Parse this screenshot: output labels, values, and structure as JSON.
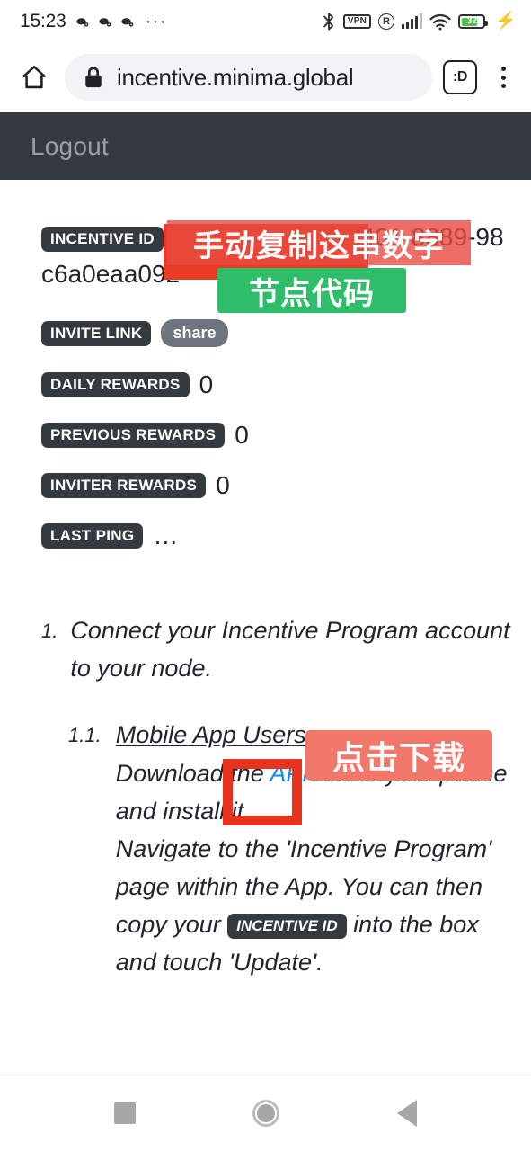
{
  "status_bar": {
    "clock": "15:23",
    "notification_icons": [
      "app-notification-icon",
      "app-notification-icon",
      "app-notification-icon"
    ],
    "overflow_dots": "···",
    "bluetooth_icon": "bluetooth-icon",
    "vpn_label": "VPN",
    "roaming_label": "R",
    "signal_icon": "cellular-signal-icon",
    "wifi_icon": "wifi-icon",
    "battery_level": "32",
    "charging_icon": "charging-bolt-icon"
  },
  "browser": {
    "home_icon": "home-icon",
    "lock_icon": "lock-icon",
    "url": "incentive.minima.global",
    "profile_label": ":D",
    "menu_icon": "overflow-menu-icon"
  },
  "site_header": {
    "logout_label": "Logout"
  },
  "content": {
    "incentive_id_label": "INCENTIVE ID",
    "incentive_id_value": "5d25f848-dedc-4401-8889-98c6a0eaa092",
    "invite_link_label": "INVITE LINK",
    "share_label": "share",
    "daily_rewards_label": "DAILY REWARDS",
    "daily_rewards_value": "0",
    "previous_rewards_label": "PREVIOUS REWARDS",
    "previous_rewards_value": "0",
    "inviter_rewards_label": "INVITER REWARDS",
    "inviter_rewards_value": "0",
    "last_ping_label": "LAST PING",
    "last_ping_value": "…"
  },
  "instructions": {
    "step1_num": "1.",
    "step1_text": "Connect your Incentive Program account to your node.",
    "step11_num": "1.1.",
    "step11_title": "Mobile App Users",
    "step11_part1": "Download the ",
    "step11_apk": "APK",
    "step11_part2": " on to your phone and install it.",
    "step11_part3": "Navigate to the 'Incentive Program' page within the App. You can then copy your ",
    "step11_inline_badge": "INCENTIVE ID",
    "step11_part4": " into the box and touch 'Update'."
  },
  "annotations": {
    "copy_digits": "手动复制这串数字",
    "node_code": "节点代码",
    "click_download": "点击下载",
    "colors": {
      "red_overlay": "#e94a40",
      "red_solid": "#ea3c24",
      "green": "#2ebd68",
      "salmon": "#f2776b",
      "outline_red": "#e8341c"
    }
  },
  "navbar": {
    "recents_icon": "recents-square-icon",
    "home_icon": "home-circle-icon",
    "back_icon": "back-triangle-icon"
  }
}
